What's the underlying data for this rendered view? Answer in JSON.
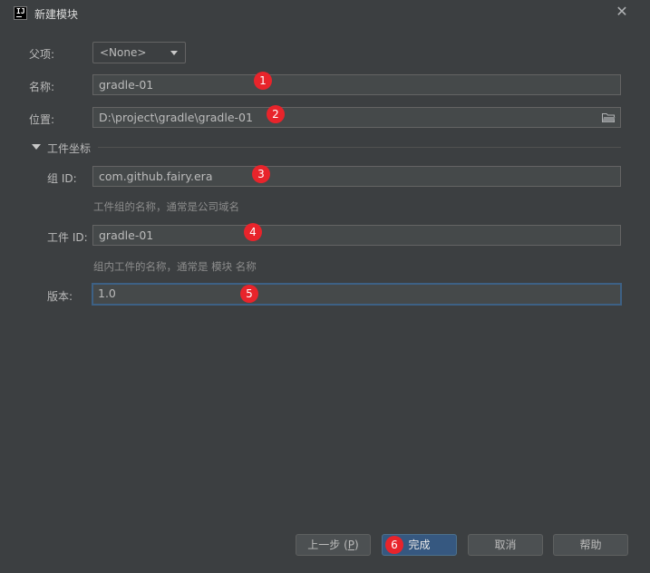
{
  "window": {
    "app_icon_text": "IJ",
    "title": "新建模块",
    "close_icon": "close-icon"
  },
  "form": {
    "parent_label": "父项:",
    "parent_value": "<None>",
    "name_label": "名称:",
    "name_value": "gradle-01",
    "location_label": "位置:",
    "location_value": "D:\\project\\gradle\\gradle-01",
    "artifact_section_label": "工件坐标",
    "group_id_label": "组 ID:",
    "group_id_value": "com.github.fairy.era",
    "group_id_hint": "工件组的名称，通常是公司域名",
    "artifact_id_label": "工件 ID:",
    "artifact_id_value": "gradle-01",
    "artifact_id_hint": "组内工件的名称，通常是 模块 名称",
    "version_label": "版本:",
    "version_value": "1.0"
  },
  "annotations": [
    "1",
    "2",
    "3",
    "4",
    "5",
    "6"
  ],
  "buttons": {
    "previous_label": "上一步 (",
    "previous_mnemonic": "P",
    "previous_suffix": ")",
    "finish_label": "完成",
    "cancel_label": "取消",
    "help_label": "帮助"
  },
  "colors": {
    "background": "#3c3f41",
    "field_background": "#45494a",
    "focus_border": "#3d6185",
    "primary_button": "#365880",
    "annotation_badge": "#e8242b"
  }
}
